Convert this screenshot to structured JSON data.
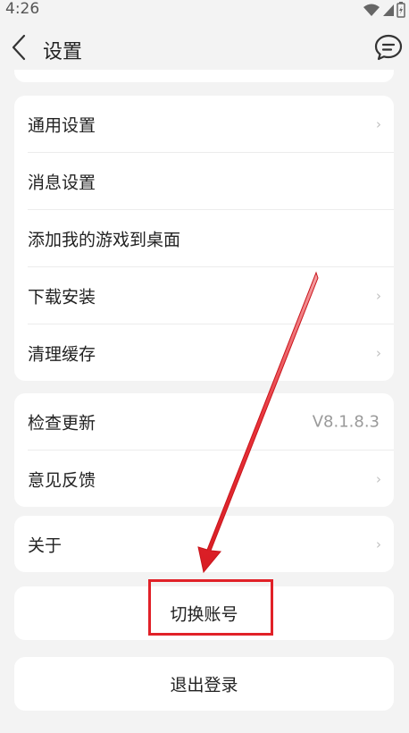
{
  "status": {
    "time": "4:26"
  },
  "header": {
    "title": "设置"
  },
  "group1": [
    {
      "label": "通用设置",
      "chevron": true
    },
    {
      "label": "消息设置",
      "chevron": false
    },
    {
      "label": "添加我的游戏到桌面",
      "chevron": false
    },
    {
      "label": "下载安装",
      "chevron": true
    },
    {
      "label": "清理缓存",
      "chevron": true
    }
  ],
  "group2": {
    "check_update": {
      "label": "检查更新",
      "value": "V8.1.8.3"
    },
    "feedback": {
      "label": "意见反馈"
    }
  },
  "about": {
    "label": "关于"
  },
  "switch_account": {
    "label": "切换账号"
  },
  "logout": {
    "label": "退出登录"
  },
  "icons": {
    "back": "chevron-left-icon",
    "message": "message-bubble-icon",
    "chevron": "chevron-right-icon"
  },
  "colors": {
    "annotation": "#e12128",
    "background": "#f3f3f3"
  }
}
